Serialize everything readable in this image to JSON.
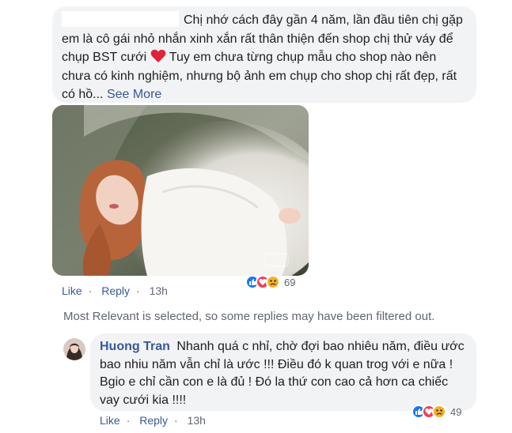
{
  "comment": {
    "text_line1": "Chị nhớ cách đây gần 4 năm, lần đầu tiên chị gặp",
    "text_line2": "em là cô gái nhỏ nhắn xinh xắn rất thân thiện đến shop chị thử váy để",
    "text_line3_a": "chụp BST cưới",
    "text_line3_b": " Tuy em chưa từng chụp mẫu cho shop nào nên",
    "text_line4": "chưa có kinh nghiệm, nhưng bộ ảnh em chụp cho shop chị rất đẹp, rất",
    "text_line5": "có hồ...",
    "see_more": "See More",
    "heart_icon": "red-heart-icon",
    "like": "Like",
    "reply": "Reply",
    "time": "13h",
    "reaction_count": "69",
    "reactions": [
      "like-reaction-icon",
      "love-reaction-icon",
      "sad-reaction-icon"
    ]
  },
  "filter_note": "Most Relevant is selected, so some replies may have been filtered out.",
  "reply": {
    "author": "Huong Tran",
    "line1": "Nhanh quá c nhỉ, chờ đợi bao nhiêu năm, điều ước",
    "line2": "bao nhiu năm vẫn chỉ là ước !!! Điều đó k quan trog với e nữa !",
    "line3": "Bgio e chỉ cần con e là đủ ! Đó la thứ con cao cả hơn ca chiếc",
    "line4": "vay cưới kia !!!!",
    "like": "Like",
    "reply": "Reply",
    "time": "13h",
    "reaction_count": "49",
    "reactions": [
      "like-reaction-icon",
      "love-reaction-icon",
      "sad-reaction-icon"
    ]
  },
  "colors": {
    "link": "#385898",
    "bubble": "#f2f3f5",
    "meta": "#606770",
    "like_blue": "#1877f2",
    "love_red": "#f33e58",
    "sad_yellow": "#f7b125"
  }
}
